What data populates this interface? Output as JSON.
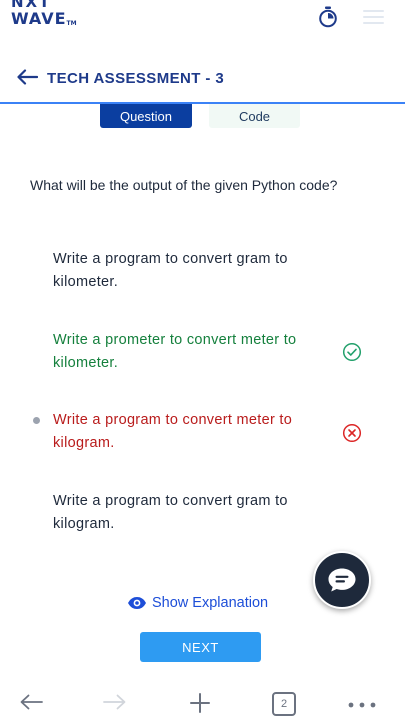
{
  "brand": {
    "line1": "NXT",
    "line2": "WAVE",
    "tm": "TM"
  },
  "icons": {
    "timer": "stopwatch-icon",
    "menu": "hamburger-menu-icon",
    "back": "arrow-left-icon",
    "correct": "check-circle-icon",
    "wrong": "x-circle-icon",
    "chat": "chat-bubble-icon",
    "eye": "eye-icon"
  },
  "header": {
    "title": "TECH ASSESSMENT - 3"
  },
  "tabs": [
    {
      "label": "Question",
      "active": true
    },
    {
      "label": "Code",
      "active": false
    }
  ],
  "question": {
    "text": "What will be the output of the given Python code?"
  },
  "options": [
    {
      "text": "Write a program to convert gram to kilometer.",
      "state": "default"
    },
    {
      "text": "Write a prometer to convert meter to kilometer.",
      "state": "correct"
    },
    {
      "text": "Write a program to convert meter to kilogram.",
      "state": "wrong-selected"
    },
    {
      "text": "Write a program to convert gram to kilogram.",
      "state": "default"
    }
  ],
  "actions": {
    "show_explanation": "Show Explanation",
    "next": "NEXT"
  },
  "browser_nav": {
    "tab_count": "2"
  },
  "colors": {
    "brand": "#1e3a8a",
    "active_tab": "#0b3ea0",
    "correct": "#15803d",
    "wrong": "#b91c1c",
    "next_button": "#2e9bf2"
  }
}
